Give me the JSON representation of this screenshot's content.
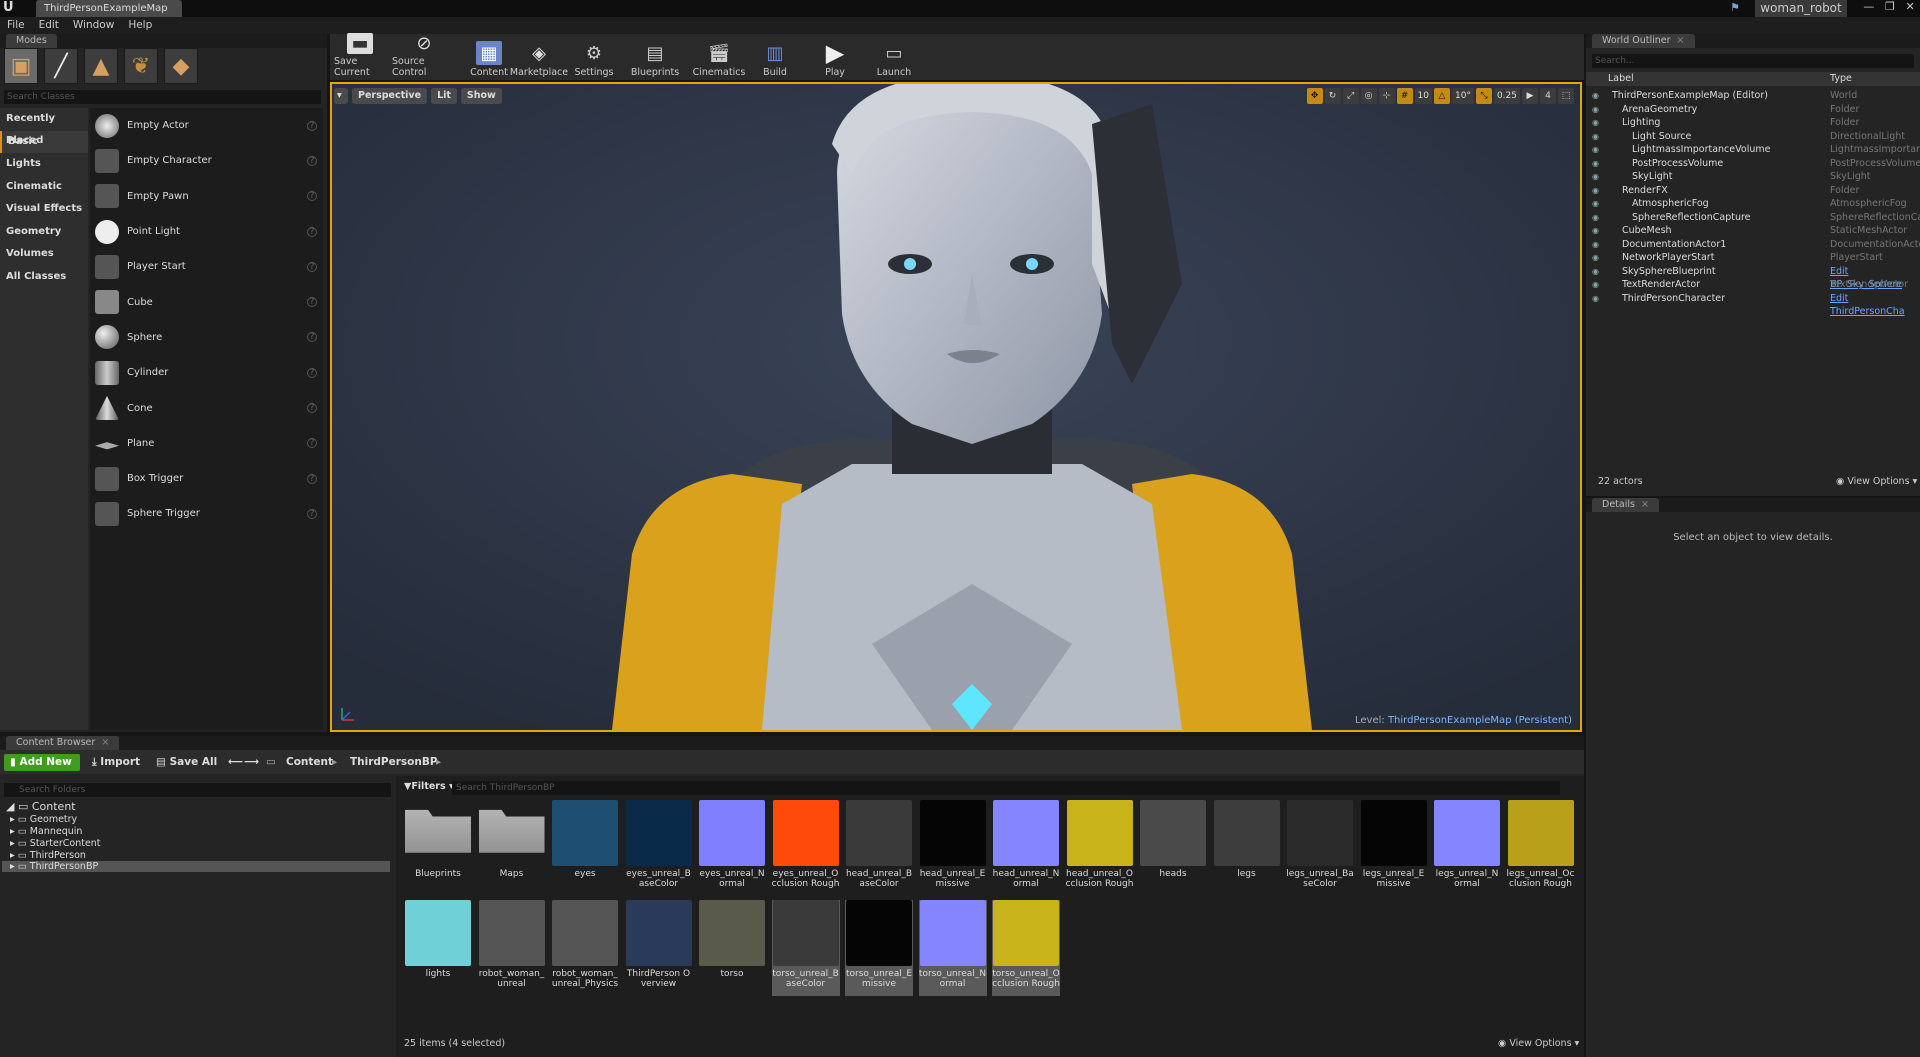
{
  "window": {
    "doc_tab": "ThirdPersonExampleMap",
    "user": "woman_robot",
    "buttons": [
      "—",
      "❐",
      "✕"
    ]
  },
  "menu": [
    "File",
    "Edit",
    "Window",
    "Help"
  ],
  "modes": {
    "tab": "Modes",
    "search_placeholder": "Search Classes",
    "categories": [
      "Recently Placed",
      "Basic",
      "Lights",
      "Cinematic",
      "Visual Effects",
      "Geometry",
      "Volumes",
      "All Classes"
    ],
    "selected_category": "Basic",
    "items": [
      "Empty Actor",
      "Empty Character",
      "Empty Pawn",
      "Point Light",
      "Player Start",
      "Cube",
      "Sphere",
      "Cylinder",
      "Cone",
      "Plane",
      "Box Trigger",
      "Sphere Trigger"
    ]
  },
  "toolbar": [
    "Save Current",
    "Source Control",
    "Content",
    "Marketplace",
    "Settings",
    "Blueprints",
    "Cinematics",
    "Build",
    "Play",
    "Launch"
  ],
  "viewport": {
    "perspective": "Perspective",
    "lit": "Lit",
    "show": "Show",
    "grid_snap": "10",
    "rot_snap": "10°",
    "scale_snap": "0.25",
    "cam_speed": "4",
    "level_prefix": "Level:",
    "level_name": "ThirdPersonExampleMap (Persistent)"
  },
  "outliner": {
    "tab": "World Outliner",
    "search_placeholder": "Search...",
    "col_label": "Label",
    "col_type": "Type",
    "rows": [
      {
        "label": "ThirdPersonExampleMap (Editor)",
        "type": "World",
        "indent": 0
      },
      {
        "label": "ArenaGeometry",
        "type": "Folder",
        "indent": 1
      },
      {
        "label": "Lighting",
        "type": "Folder",
        "indent": 1
      },
      {
        "label": "Light Source",
        "type": "DirectionalLight",
        "indent": 2
      },
      {
        "label": "LightmassImportanceVolume",
        "type": "LightmassImportance",
        "indent": 2
      },
      {
        "label": "PostProcessVolume",
        "type": "PostProcessVolume",
        "indent": 2
      },
      {
        "label": "SkyLight",
        "type": "SkyLight",
        "indent": 2
      },
      {
        "label": "RenderFX",
        "type": "Folder",
        "indent": 1
      },
      {
        "label": "AtmosphericFog",
        "type": "AtmosphericFog",
        "indent": 2
      },
      {
        "label": "SphereReflectionCapture",
        "type": "SphereReflectionCapt",
        "indent": 2
      },
      {
        "label": "CubeMesh",
        "type": "StaticMeshActor",
        "indent": 1
      },
      {
        "label": "DocumentationActor1",
        "type": "DocumentationActor",
        "indent": 1
      },
      {
        "label": "NetworkPlayerStart",
        "type": "PlayerStart",
        "indent": 1
      },
      {
        "label": "SkySphereBlueprint",
        "type": "Edit BP_Sky_Sphere",
        "indent": 1,
        "link": true
      },
      {
        "label": "TextRenderActor",
        "type": "TextRenderActor",
        "indent": 1
      },
      {
        "label": "ThirdPersonCharacter",
        "type": "Edit ThirdPersonCha",
        "indent": 1,
        "link": true
      }
    ],
    "actor_count": "22 actors",
    "view_options": "View Options"
  },
  "details": {
    "tab": "Details",
    "empty_text": "Select an object to view details."
  },
  "content_browser": {
    "tab": "Content Browser",
    "add_new": "Add New",
    "import": "Import",
    "save_all": "Save All",
    "breadcrumb": [
      "Content",
      "ThirdPersonBP"
    ],
    "folder_search_placeholder": "Search Folders",
    "folders": {
      "root": "Content",
      "children": [
        "Geometry",
        "Mannequin",
        "StarterContent",
        "ThirdPerson",
        "ThirdPersonBP"
      ]
    },
    "filters": "Filters",
    "asset_search_placeholder": "Search ThirdPersonBP",
    "assets": [
      {
        "name": "Blueprints",
        "color": "#9a9a9a",
        "sel": false
      },
      {
        "name": "Maps",
        "color": "#9a9a9a",
        "sel": false
      },
      {
        "name": "eyes",
        "color": "#1d4f72",
        "sel": false
      },
      {
        "name": "eyes_unreal_BaseColor",
        "color": "#0a2a4a",
        "sel": false
      },
      {
        "name": "eyes_unreal_Normal",
        "color": "#8080ff",
        "sel": false
      },
      {
        "name": "eyes_unreal_Occlusion Roughness",
        "color": "#ff4a0a",
        "sel": false
      },
      {
        "name": "head_unreal_BaseColor",
        "color": "#3a3a3a",
        "sel": false
      },
      {
        "name": "head_unreal_Emissive",
        "color": "#050505",
        "sel": false
      },
      {
        "name": "head_unreal_Normal",
        "color": "#8585ff",
        "sel": false
      },
      {
        "name": "head_unreal_Occlusion Roughness",
        "color": "#c8b41a",
        "sel": false
      },
      {
        "name": "heads",
        "color": "#4a4a4a",
        "sel": false
      },
      {
        "name": "legs",
        "color": "#3d3d3d",
        "sel": false
      },
      {
        "name": "legs_unreal_BaseColor",
        "color": "#2a2a2a",
        "sel": false
      },
      {
        "name": "legs_unreal_Emissive",
        "color": "#050505",
        "sel": false
      },
      {
        "name": "legs_unreal_Normal",
        "color": "#8585ff",
        "sel": false
      },
      {
        "name": "legs_unreal_Occlusion Roughness",
        "color": "#b8a01a",
        "sel": false
      },
      {
        "name": "lights",
        "color": "#6fd0d8",
        "sel": false
      },
      {
        "name": "robot_woman_unreal",
        "color": "#555555",
        "sel": false
      },
      {
        "name": "robot_woman_unreal_Physics Asset",
        "color": "#555555",
        "sel": false
      },
      {
        "name": "ThirdPerson Overview",
        "color": "#2a3a5a",
        "sel": false
      },
      {
        "name": "torso",
        "color": "#5a5a4a",
        "sel": false
      },
      {
        "name": "torso_unreal_BaseColor",
        "color": "#3a3a3a",
        "sel": true
      },
      {
        "name": "torso_unreal_Emissive",
        "color": "#050505",
        "sel": true
      },
      {
        "name": "torso_unreal_Normal",
        "color": "#8585ff",
        "sel": true
      },
      {
        "name": "torso_unreal_Occlusion Roughness",
        "color": "#c8b41a",
        "sel": true
      }
    ],
    "status": "25 items (4 selected)",
    "view_options": "View Options"
  }
}
